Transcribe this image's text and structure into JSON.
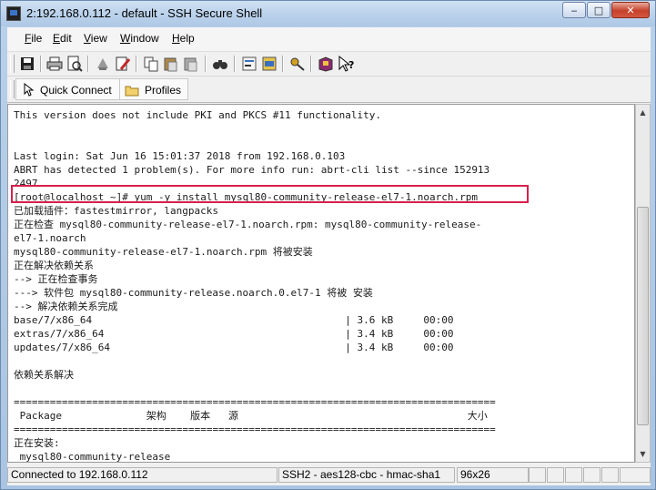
{
  "window": {
    "title": "2:192.168.0.112 - default - SSH Secure Shell",
    "min_glyph": "‒",
    "max_glyph": "□",
    "close_glyph": "✕"
  },
  "menu": {
    "items": [
      {
        "accel": "F",
        "rest": "ile"
      },
      {
        "accel": "E",
        "rest": "dit"
      },
      {
        "accel": "V",
        "rest": "iew"
      },
      {
        "accel": "W",
        "rest": "indow"
      },
      {
        "accel": "H",
        "rest": "elp"
      }
    ]
  },
  "toolbar": {
    "buttons": [
      "save-icon",
      "print-icon",
      "print-preview-icon",
      "disconnect-icon",
      "edit-icon",
      "copy-icon",
      "paste-icon",
      "paste-alt-icon",
      "find-icon",
      "settings-icon",
      "profiles-icon",
      "key-icon",
      "help-book-icon",
      "context-help-icon"
    ]
  },
  "quickbar": {
    "quick_connect": "Quick Connect",
    "profiles": "Profiles"
  },
  "terminal": {
    "lines": [
      "This version does not include PKI and PKCS #11 functionality.",
      "",
      "",
      "Last login: Sat Jun 16 15:01:37 2018 from 192.168.0.103",
      "ABRT has detected 1 problem(s). For more info run: abrt-cli list --since 152913",
      "2497",
      "[root@localhost ~]# yum -y install mysql80-community-release-el7-1.noarch.rpm",
      "已加载插件：fastestmirror, langpacks",
      "正在检查 mysql80-community-release-el7-1.noarch.rpm: mysql80-community-release-",
      "el7-1.noarch",
      "mysql80-community-release-el7-1.noarch.rpm 将被安装",
      "正在解决依赖关系",
      "--> 正在检查事务",
      "---> 软件包 mysql80-community-release.noarch.0.el7-1 将被 安装",
      "--> 解决依赖关系完成",
      "base/7/x86_64                                          | 3.6 kB     00:00",
      "extras/7/x86_64                                        | 3.4 kB     00:00",
      "updates/7/x86_64                                       | 3.4 kB     00:00",
      "",
      "依赖关系解决",
      "",
      "================================================================================",
      " Package              架构    版本   源                                      大小",
      "================================================================================",
      "正在安装:",
      " mysql80-community-release"
    ]
  },
  "status": {
    "connection": "Connected to 192.168.0.112",
    "cipher": "SSH2 - aes128-cbc - hmac-sha1",
    "size": "96x26"
  },
  "colors": {
    "highlight_box": "#d8204b"
  }
}
